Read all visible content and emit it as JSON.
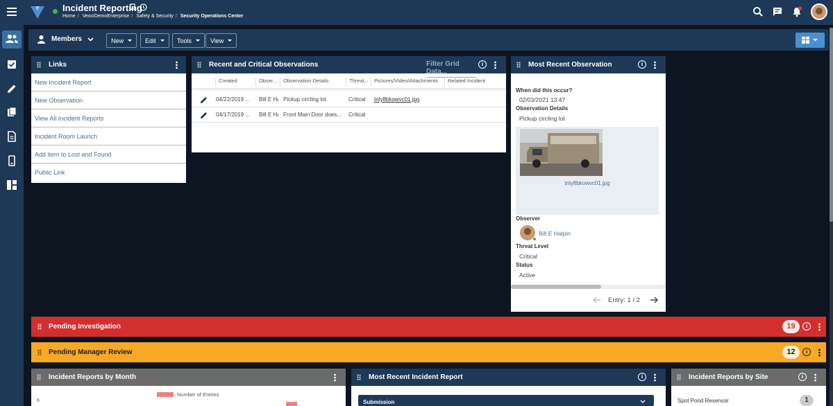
{
  "header": {
    "app_title": "Incident Reporting",
    "breadcrumb": [
      "Home",
      "VeociDemoEnterprise",
      "Safety & Security",
      "Security Operations Center"
    ],
    "notification_dot_color": "#e53935"
  },
  "toolbar": {
    "members_label": "Members",
    "new_label": "New",
    "edit_label": "Edit",
    "tools_label": "Tools",
    "view_label": "View"
  },
  "links_panel": {
    "title": "Links",
    "items": [
      {
        "label": "New Incident Report"
      },
      {
        "label": "New Observation"
      },
      {
        "label": "View All Incident Reports"
      },
      {
        "label": "Incident Room Launch"
      },
      {
        "label": "Add item to Lost and Found"
      },
      {
        "label": "Public Link"
      }
    ]
  },
  "observations_panel": {
    "title": "Recent and Critical Observations",
    "filter_placeholder": "Filter Grid Data...",
    "columns": [
      "Created",
      "Obser...",
      "Observation Details",
      "Threat...",
      "Pictures/Video/Attachments",
      "Related Incident"
    ],
    "rows": [
      {
        "created": "04/22/2019 ...",
        "observer": "Bill E Ha",
        "details": "Pickup circling lot",
        "threat": "Critical",
        "attachment": "tnly8bkowvc01.jpg"
      },
      {
        "created": "04/17/2019 ...",
        "observer": "Bill E Ha",
        "details": "Front Main Door does...",
        "threat": "Critical",
        "attachment": ""
      }
    ]
  },
  "recent_observation": {
    "title": "Most Recent Observation",
    "when_label": "When did this occur?",
    "when_value": "02/03/2021 13:47",
    "details_label": "Observation Details",
    "details_value": "Pickup circling lot",
    "image_caption": "tnly8bkowvc01.jpg",
    "observer_label": "Observer",
    "observer_value": "Bill E Halpin",
    "threat_label": "Threat Level",
    "threat_value": "Critical",
    "status_label": "Status",
    "status_value": "Active",
    "entry_text": "Entry: 1 / 2"
  },
  "pending_investigation": {
    "title": "Pending Investigation",
    "count": "19",
    "color": "#d32f2f"
  },
  "pending_review": {
    "title": "Pending Manager Review",
    "count": "12",
    "color": "#f9a825"
  },
  "reports_by_month": {
    "title": "Incident Reports by Month",
    "legend": "Number of Entries",
    "y_tick": "6"
  },
  "recent_incident": {
    "title": "Most Recent Incident Report",
    "sub_label": "Submission"
  },
  "reports_by_site": {
    "title": "Incident Reports by Site",
    "first_site": "Spot Pond Reservoir",
    "first_count": "1"
  }
}
